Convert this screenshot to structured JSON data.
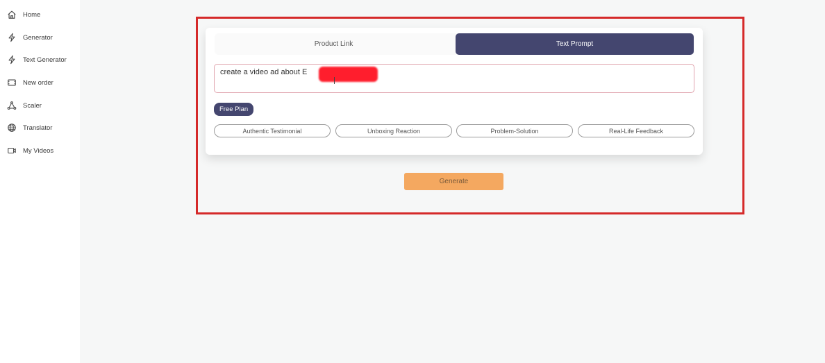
{
  "sidebar": {
    "items": [
      {
        "label": "Home",
        "icon": "home-icon"
      },
      {
        "label": "Generator",
        "icon": "bolt-icon"
      },
      {
        "label": "Text Generator",
        "icon": "bolt-icon"
      },
      {
        "label": "New order",
        "icon": "film-icon"
      },
      {
        "label": "Scaler",
        "icon": "network-icon"
      },
      {
        "label": "Translator",
        "icon": "globe-icon"
      },
      {
        "label": "My Videos",
        "icon": "video-icon"
      }
    ]
  },
  "tabs": {
    "product_link": "Product Link",
    "text_prompt": "Text Prompt",
    "active": "Text Prompt"
  },
  "prompt": {
    "value": "create a video ad about E"
  },
  "plan_badge": "Free Plan",
  "chips": [
    "Authentic Testimonial",
    "Unboxing Reaction",
    "Problem-Solution",
    "Real-Life Feedback"
  ],
  "generate_label": "Generate",
  "colors": {
    "accent": "#44466f",
    "generate": "#f4a860",
    "highlight": "#d52a2a"
  }
}
